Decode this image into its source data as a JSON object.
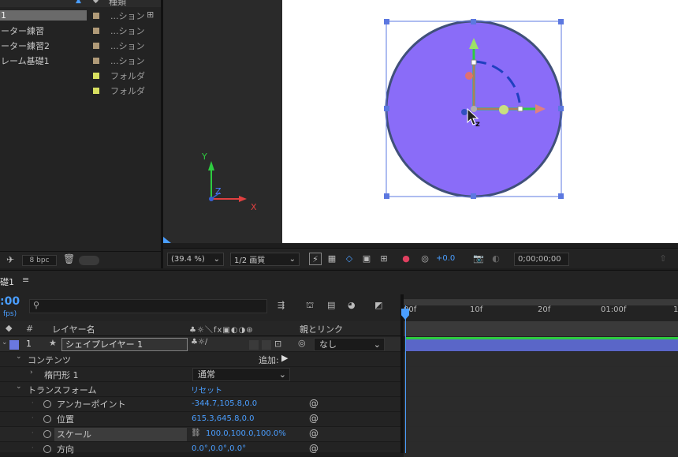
{
  "project": {
    "header_col": "種類",
    "rows": [
      {
        "name": "1",
        "type": "...ション",
        "color": "#b09a78",
        "selected": true
      },
      {
        "name": "ーター練習",
        "type": "...ション",
        "color": "#b09a78"
      },
      {
        "name": "ーター練習2",
        "type": "...ション",
        "color": "#b09a78"
      },
      {
        "name": "レーム基礎1",
        "type": "...ション",
        "color": "#b09a78"
      },
      {
        "name": "",
        "type": "フォルダ",
        "color": "#d8e060"
      },
      {
        "name": "",
        "type": "フォルダ",
        "color": "#d8e060"
      }
    ],
    "bpc": "8 bpc"
  },
  "viewer": {
    "axis_y": "Y",
    "axis_z": "Z",
    "axis_x": "X",
    "cursor_z": "z",
    "zoom": "(39.4 %)",
    "resolution": "1/2 画質",
    "exposure": "+0.0",
    "timecode": "0;00;00;00"
  },
  "timeline": {
    "comp_name": "礎1",
    "time": ":00",
    "fps": "fps)",
    "search_placeholder": "",
    "col_num": "#",
    "col_layer": "レイヤー名",
    "col_parent": "親とリンク",
    "layer": {
      "num": "1",
      "name": "シェイプレイヤー 1",
      "parent": "なし",
      "color": "#6a78e0"
    },
    "contents": "コンテンツ",
    "add": "追加:",
    "ellipse": "楕円形 1",
    "blend": "通常",
    "transform": "トランスフォーム",
    "reset": "リセット",
    "props": [
      {
        "name": "アンカーポイント",
        "value": "-344.7,105.8,0.0"
      },
      {
        "name": "位置",
        "value": "615.3,645.8,0.0"
      },
      {
        "name": "スケール",
        "value": "100.0,100.0,100.0%"
      },
      {
        "name": "方向",
        "value": "0.0°,0.0°,0.0°"
      }
    ],
    "ruler": [
      "00f",
      "10f",
      "20f",
      "01:00f",
      "1"
    ]
  }
}
